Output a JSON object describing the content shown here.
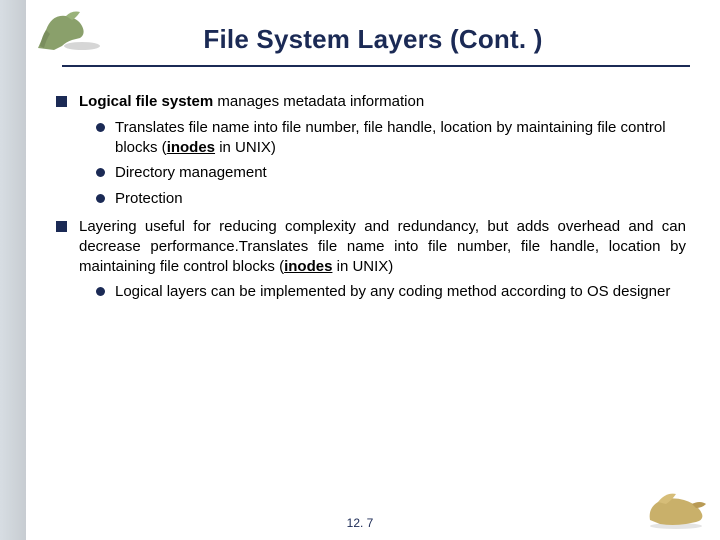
{
  "title": "File System Layers (Cont. )",
  "bullets": {
    "b1": {
      "lead": "Logical file system",
      "rest": " manages metadata information",
      "sub": {
        "s1a": "Translates file name into file number, file handle, location by maintaining file control blocks (",
        "s1_inodes": "inodes",
        "s1b": " in UNIX)",
        "s2": "Directory management",
        "s3": "Protection"
      }
    },
    "b2": {
      "texta": "Layering useful for reducing complexity and redundancy, but adds overhead and can decrease performance.Translates file name into file number, file handle, location by maintaining file control blocks (",
      "inodes": "inodes",
      "textb": " in UNIX)",
      "sub": {
        "s1": "Logical layers can be implemented by any coding method according to OS designer"
      }
    }
  },
  "footer": "12. 7",
  "icons": {
    "dino_tl": "dinosaur-top-left",
    "dino_br": "dinosaur-bottom-right"
  },
  "colors": {
    "accent": "#1b2a55",
    "sidebar": "#c7ccd1"
  }
}
